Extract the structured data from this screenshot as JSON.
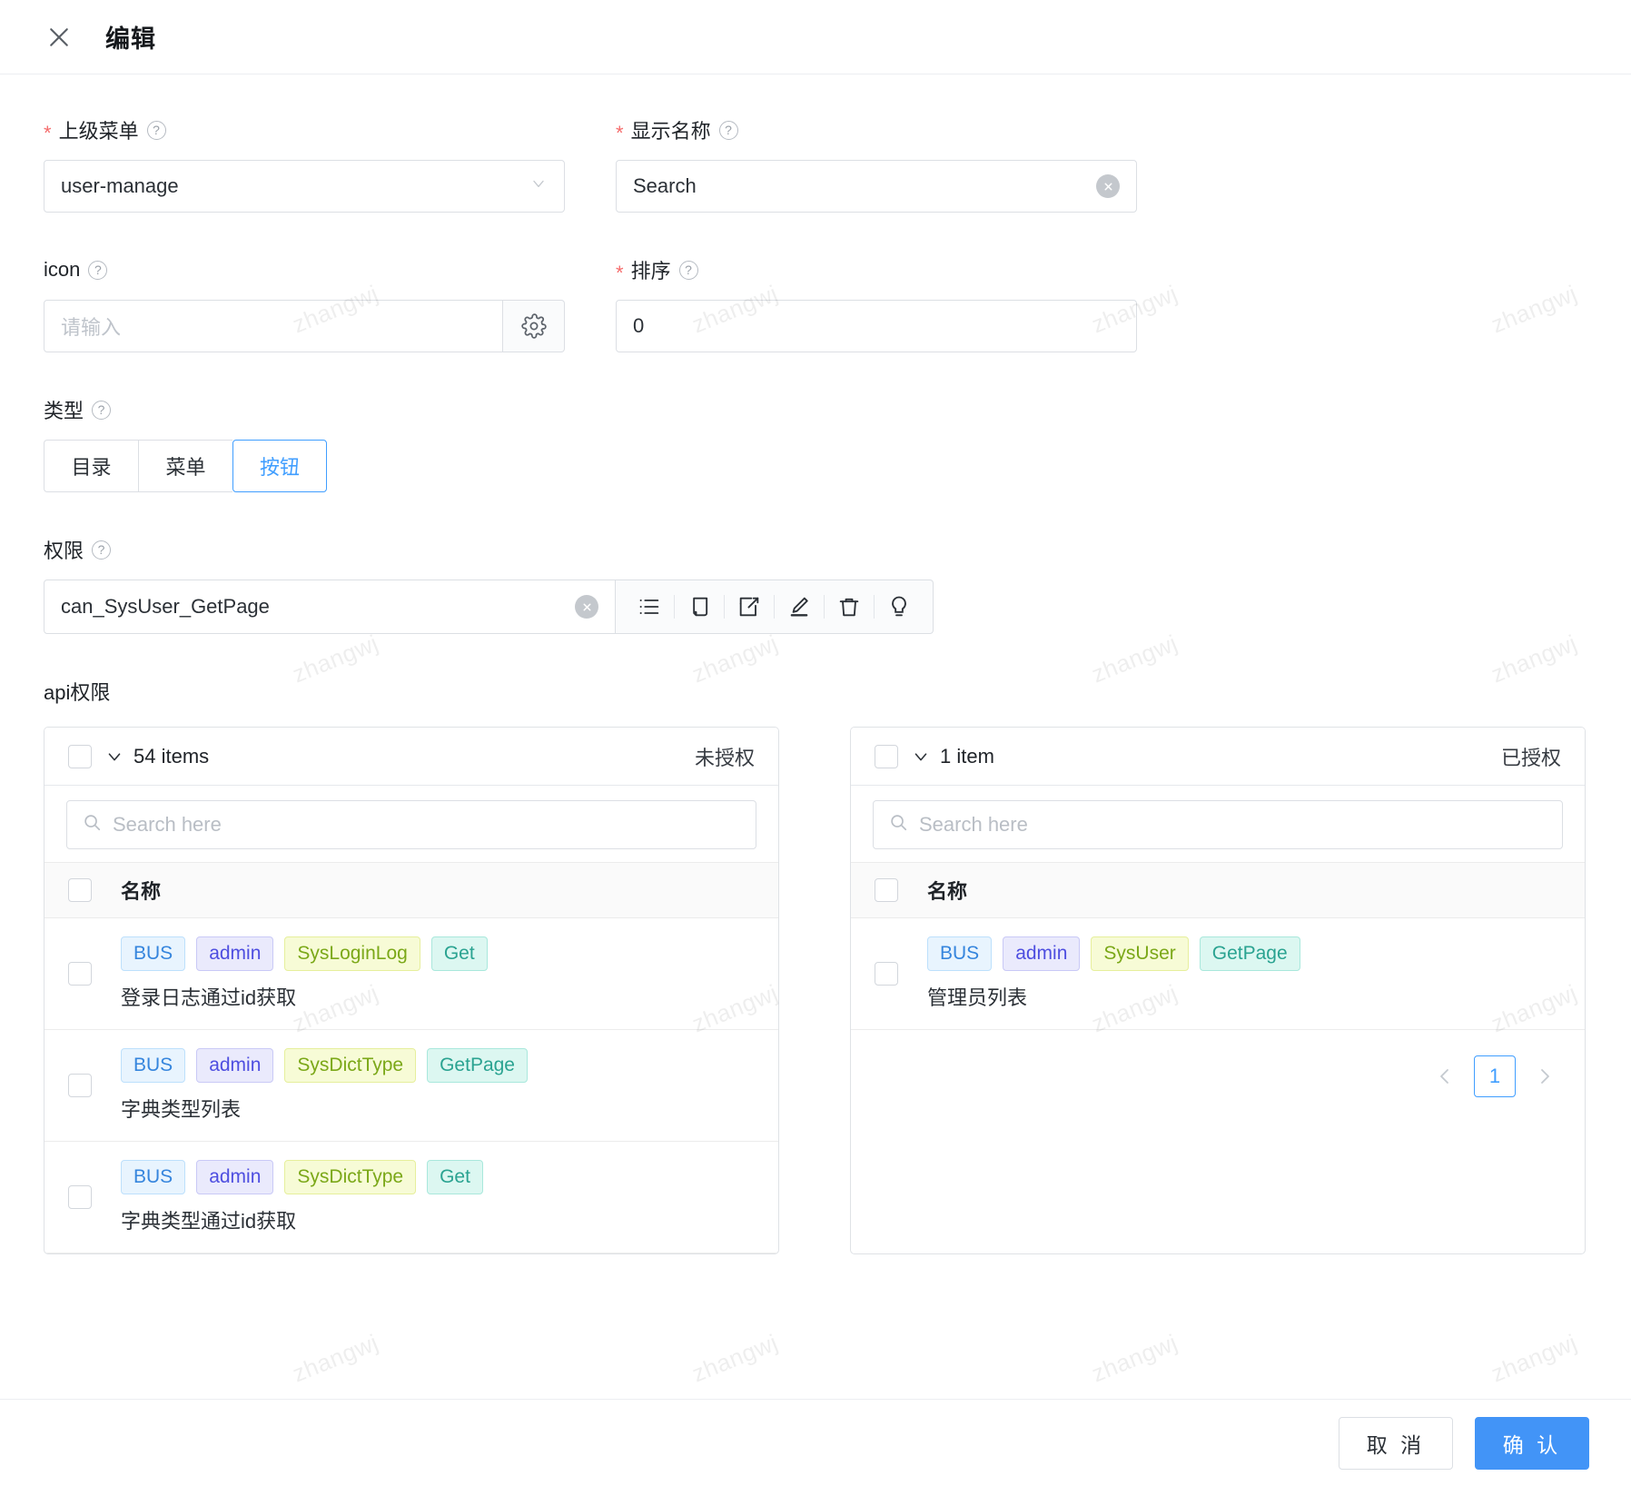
{
  "header": {
    "title": "编辑",
    "close_icon": "close-icon"
  },
  "form": {
    "parent_menu": {
      "label": "上级菜单",
      "required": true,
      "value": "user-manage",
      "help_icon": "question-circle-icon",
      "dropdown_icon": "chevron-down-icon"
    },
    "display_name": {
      "label": "显示名称",
      "required": true,
      "value": "Search",
      "help_icon": "question-circle-icon",
      "clear_icon": "clear-circle-icon"
    },
    "icon_field": {
      "label": "icon",
      "required": false,
      "value": "",
      "placeholder": "请输入",
      "help_icon": "question-circle-icon",
      "picker_icon": "gear-icon"
    },
    "sort": {
      "label": "排序",
      "required": true,
      "value": "0",
      "help_icon": "question-circle-icon"
    },
    "type": {
      "label": "类型",
      "help_icon": "question-circle-icon",
      "options": [
        "目录",
        "菜单",
        "按钮"
      ],
      "selected": "按钮",
      "accent_color": "#409eff"
    },
    "permission": {
      "label": "权限",
      "help_icon": "question-circle-icon",
      "value": "can_SysUser_GetPage",
      "clear_icon": "clear-circle-icon",
      "toolbar": [
        {
          "name": "list-icon",
          "title": "列表"
        },
        {
          "name": "copy-icon",
          "title": "复制"
        },
        {
          "name": "edit-square-icon",
          "title": "编辑"
        },
        {
          "name": "pen-underline-icon",
          "title": "标注"
        },
        {
          "name": "trash-icon",
          "title": "删除"
        },
        {
          "name": "bulb-icon",
          "title": "提示"
        }
      ]
    }
  },
  "api_permission": {
    "section_label": "api权限",
    "left_panel": {
      "count_label": "54 items",
      "state_label": "未授权",
      "search_placeholder": "Search here",
      "search_icon": "search-icon",
      "column_header": "名称",
      "rows": [
        {
          "tags": [
            "BUS",
            "admin",
            "SysLoginLog",
            "Get"
          ],
          "desc": "登录日志通过id获取",
          "checked": false
        },
        {
          "tags": [
            "BUS",
            "admin",
            "SysDictType",
            "GetPage"
          ],
          "desc": "字典类型列表",
          "checked": false
        },
        {
          "tags": [
            "BUS",
            "admin",
            "SysDictType",
            "Get"
          ],
          "desc": "字典类型通过id获取",
          "checked": false
        }
      ]
    },
    "right_panel": {
      "count_label": "1 item",
      "state_label": "已授权",
      "search_placeholder": "Search here",
      "search_icon": "search-icon",
      "column_header": "名称",
      "rows": [
        {
          "tags": [
            "BUS",
            "admin",
            "SysUser",
            "GetPage"
          ],
          "desc": "管理员列表",
          "checked": false
        }
      ],
      "pagination": {
        "prev_icon": "chevron-left-icon",
        "next_icon": "chevron-right-icon",
        "current_page": "1"
      }
    }
  },
  "footer": {
    "cancel_label": "取 消",
    "confirm_label": "确 认",
    "confirm_color": "#4294f7"
  },
  "watermark": {
    "text": "zhangwj"
  }
}
